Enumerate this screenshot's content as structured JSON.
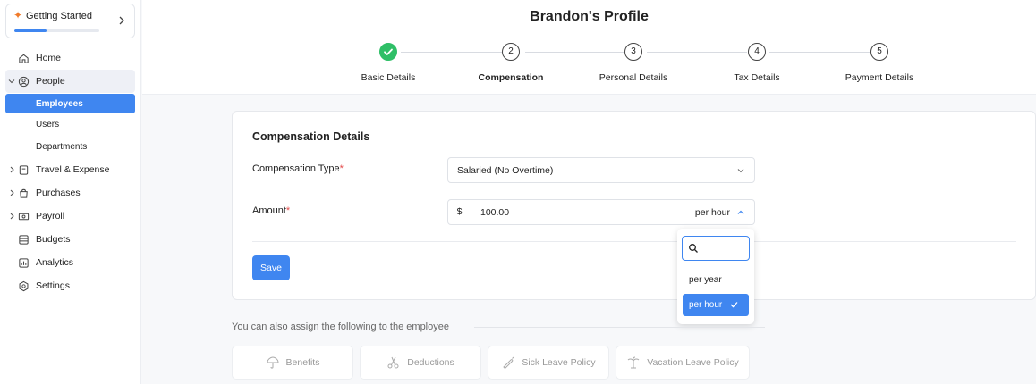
{
  "sidebar": {
    "getting_started": {
      "label": "Getting Started",
      "progress": 0.38
    },
    "items": [
      {
        "label": "Home",
        "icon": "home-icon"
      },
      {
        "label": "People",
        "icon": "people-icon",
        "expanded": true,
        "children": [
          {
            "label": "Employees",
            "active": true
          },
          {
            "label": "Users"
          },
          {
            "label": "Departments"
          }
        ]
      },
      {
        "label": "Travel & Expense",
        "icon": "travel-icon"
      },
      {
        "label": "Purchases",
        "icon": "purchases-icon"
      },
      {
        "label": "Payroll",
        "icon": "payroll-icon"
      },
      {
        "label": "Budgets",
        "icon": "budgets-icon"
      },
      {
        "label": "Analytics",
        "icon": "analytics-icon"
      },
      {
        "label": "Settings",
        "icon": "settings-icon"
      }
    ]
  },
  "header": {
    "title": "Brandon's Profile",
    "steps": [
      {
        "number": "1",
        "label": "Basic Details",
        "status": "done"
      },
      {
        "number": "2",
        "label": "Compensation",
        "status": "current"
      },
      {
        "number": "3",
        "label": "Personal Details",
        "status": "pending"
      },
      {
        "number": "4",
        "label": "Tax Details",
        "status": "pending"
      },
      {
        "number": "5",
        "label": "Payment Details",
        "status": "pending"
      }
    ]
  },
  "form": {
    "section_title": "Compensation Details",
    "compensation_type": {
      "label": "Compensation Type",
      "required_mark": "*",
      "value": "Salaried (No Overtime)"
    },
    "amount": {
      "label": "Amount",
      "required_mark": "*",
      "currency": "$",
      "value": "100.00",
      "unit": "per hour"
    },
    "save_label": "Save"
  },
  "unit_dropdown": {
    "search_placeholder": "",
    "options": [
      {
        "label": "per year",
        "selected": false
      },
      {
        "label": "per hour",
        "selected": true
      }
    ]
  },
  "assign": {
    "heading": "You can also assign the following to the employee",
    "items": [
      {
        "label": "Benefits",
        "icon": "umbrella-icon"
      },
      {
        "label": "Deductions",
        "icon": "scissors-icon"
      },
      {
        "label": "Sick Leave Policy",
        "icon": "thermometer-icon"
      },
      {
        "label": "Vacation Leave Policy",
        "icon": "palm-tree-icon"
      }
    ]
  },
  "colors": {
    "accent": "#3f86f0",
    "success": "#2fbf67",
    "required": "#e34a4a",
    "getting_started_spark": "#f07a2a"
  }
}
